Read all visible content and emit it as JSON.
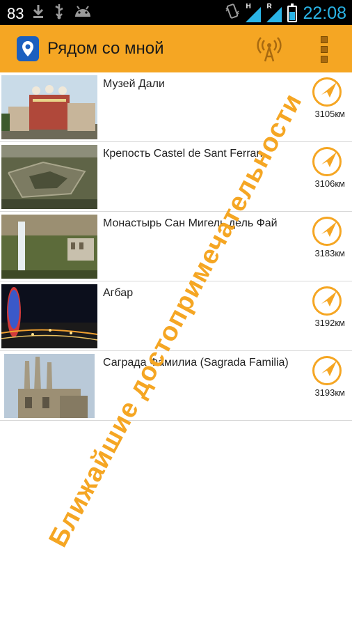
{
  "status_bar": {
    "notification_count": "83",
    "time": "22:08",
    "signal_1_letter": "H",
    "signal_2_letter": "R"
  },
  "action_bar": {
    "title": "Рядом со мной"
  },
  "places": [
    {
      "title": "Музей Дали",
      "distance": "3105км"
    },
    {
      "title": "Крепость Castel de Sant Ferran",
      "distance": "3106км"
    },
    {
      "title": "Монастырь Сан Мигель дель Фай",
      "distance": "3183км"
    },
    {
      "title": "Агбар",
      "distance": "3192км"
    },
    {
      "title": "Саграда Фамилиа  (Sagrada Familia)",
      "distance": "3193км"
    }
  ],
  "overlay_caption": "Ближайшие достопримечательности",
  "colors": {
    "accent": "#f5a623",
    "status_blue": "#2ab4e6",
    "app_icon_blue": "#1b5fbf"
  }
}
